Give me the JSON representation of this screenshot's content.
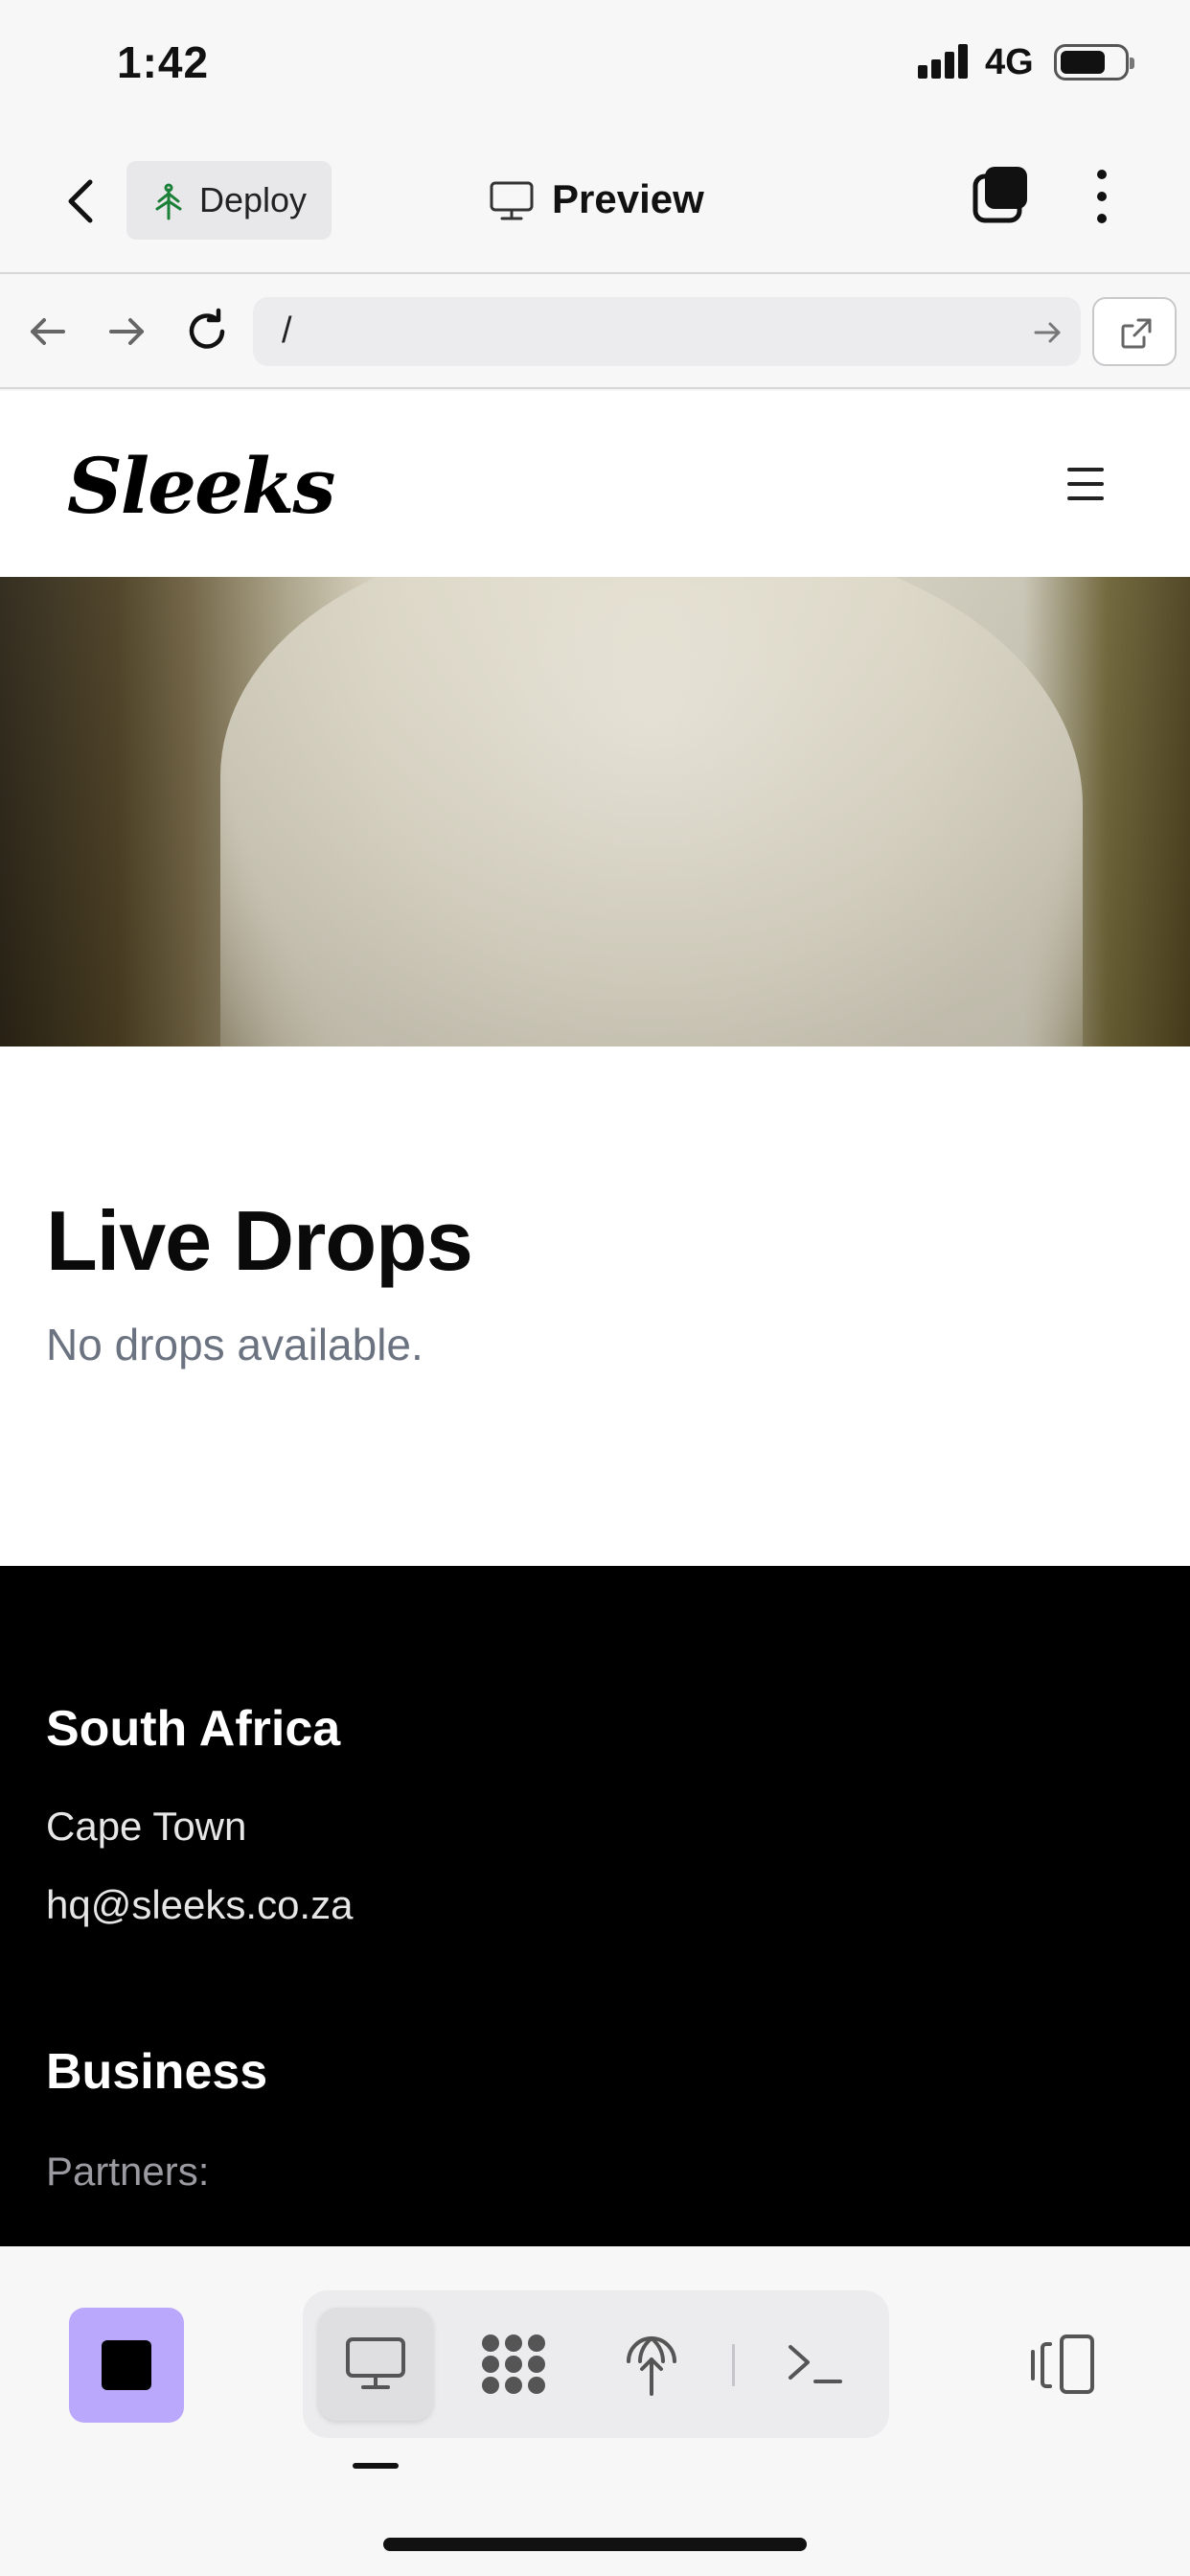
{
  "status": {
    "time": "1:42",
    "network": "4G"
  },
  "header": {
    "deploy_label": "Deploy",
    "title": "Preview"
  },
  "browser": {
    "url": "/"
  },
  "site": {
    "logo": "Sleeks",
    "drops_title": "Live Drops",
    "drops_empty": "No drops available.",
    "footer": {
      "region_title": "South Africa",
      "city": "Cape Town",
      "email": "hq@sleeks.co.za",
      "business_title": "Business",
      "partners_label": "Partners:"
    }
  },
  "icons": {
    "back": "chevron-left-icon",
    "deploy": "tree-icon",
    "preview": "monitor-icon",
    "tabs": "tabs-icon",
    "more": "kebab-icon",
    "nav_back": "arrow-left-icon",
    "nav_forward": "arrow-right-icon",
    "reload": "reload-icon",
    "open_external": "external-link-icon",
    "menu": "hamburger-icon",
    "stop": "stop-icon",
    "tab_preview": "monitor-icon",
    "tab_graph": "dots-grid-icon",
    "tab_deploy": "globe-upload-icon",
    "tab_shell": "terminal-icon",
    "toggle_panel": "panel-toggle-icon"
  },
  "colors": {
    "accent": "#b9a8fb",
    "footer_bg": "#000000",
    "muted_text": "#6b7280"
  }
}
